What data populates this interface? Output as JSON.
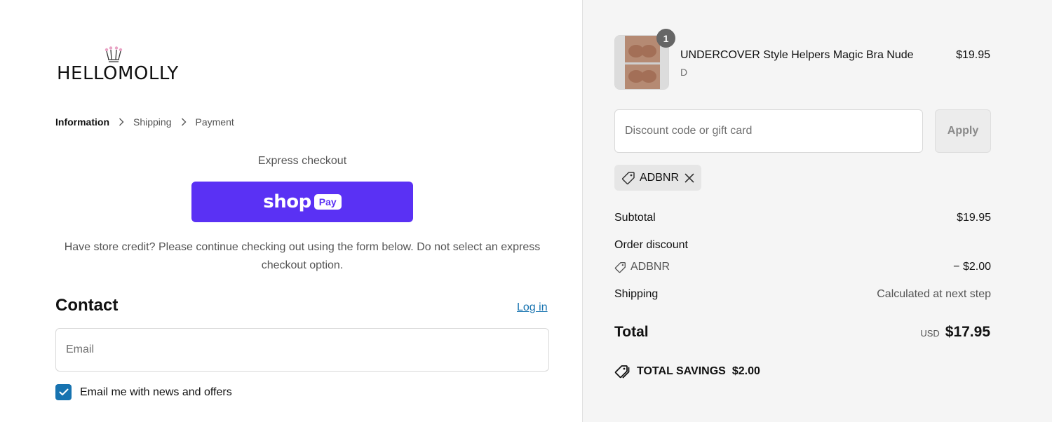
{
  "brand": {
    "name": "HELLOMOLLY",
    "accent": "#e8a2c4"
  },
  "breadcrumb": {
    "items": [
      "Information",
      "Shipping",
      "Payment"
    ],
    "active": "Information"
  },
  "express": {
    "title": "Express checkout",
    "shop_word": "shop",
    "pay_word": "Pay",
    "button_color": "#5a31f4"
  },
  "store_credit_note": "Have store credit? Please continue checking out using the form below. Do not select an express checkout option.",
  "contact": {
    "title": "Contact",
    "login_label": "Log in",
    "email_placeholder": "Email",
    "email_value": "",
    "newsletter_label": "Email me with news and offers",
    "newsletter_checked": true
  },
  "cart": {
    "item": {
      "name": "UNDERCOVER Style Helpers Magic Bra Nude",
      "variant": "D",
      "price": "$19.95",
      "quantity": "1"
    },
    "discount_placeholder": "Discount code or gift card",
    "apply_label": "Apply",
    "applied_code": "ADBNR",
    "subtotal_label": "Subtotal",
    "subtotal_value": "$19.95",
    "order_discount_label": "Order discount",
    "order_discount_code": "ADBNR",
    "order_discount_value": "− $2.00",
    "shipping_label": "Shipping",
    "shipping_value": "Calculated at next step",
    "total_label": "Total",
    "total_currency": "USD",
    "total_value": "$17.95",
    "savings_label": "TOTAL SAVINGS",
    "savings_value": "$2.00"
  },
  "colors": {
    "link": "#1773b0",
    "sidebar_bg": "#f5f5f5"
  }
}
